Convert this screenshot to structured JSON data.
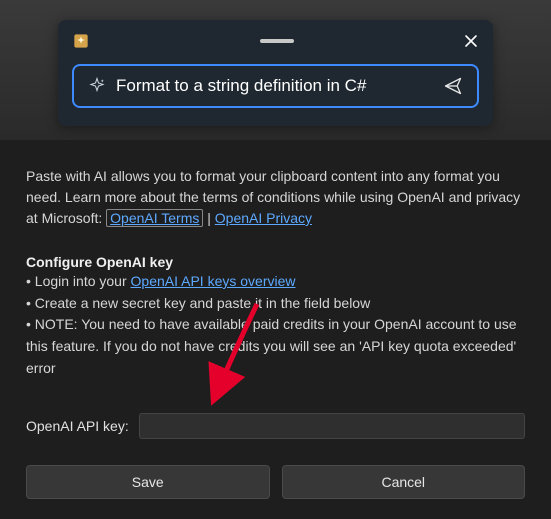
{
  "promptCard": {
    "prompt_text": "Format to a string definition in C#"
  },
  "intro": {
    "line1": "Paste with AI allows you to format your clipboard content into any format you need. Learn more about the terms of conditions while using OpenAI and privacy at Microsoft: ",
    "link1_label": "OpenAI Terms",
    "separator": " | ",
    "link2_label": "OpenAI Privacy"
  },
  "config": {
    "heading": "Configure OpenAI key",
    "bullet1_prefix": "• Login into your ",
    "bullet1_link": "OpenAI API keys overview",
    "bullet2": "• Create a new secret key and paste it in the field below",
    "bullet3": "• NOTE: You need to have available paid credits in your OpenAI account to use this feature. If you do not have credits you will see an 'API key quota exceeded' error"
  },
  "form": {
    "api_key_label": "OpenAI API key:",
    "api_key_value": ""
  },
  "buttons": {
    "save": "Save",
    "cancel": "Cancel"
  }
}
